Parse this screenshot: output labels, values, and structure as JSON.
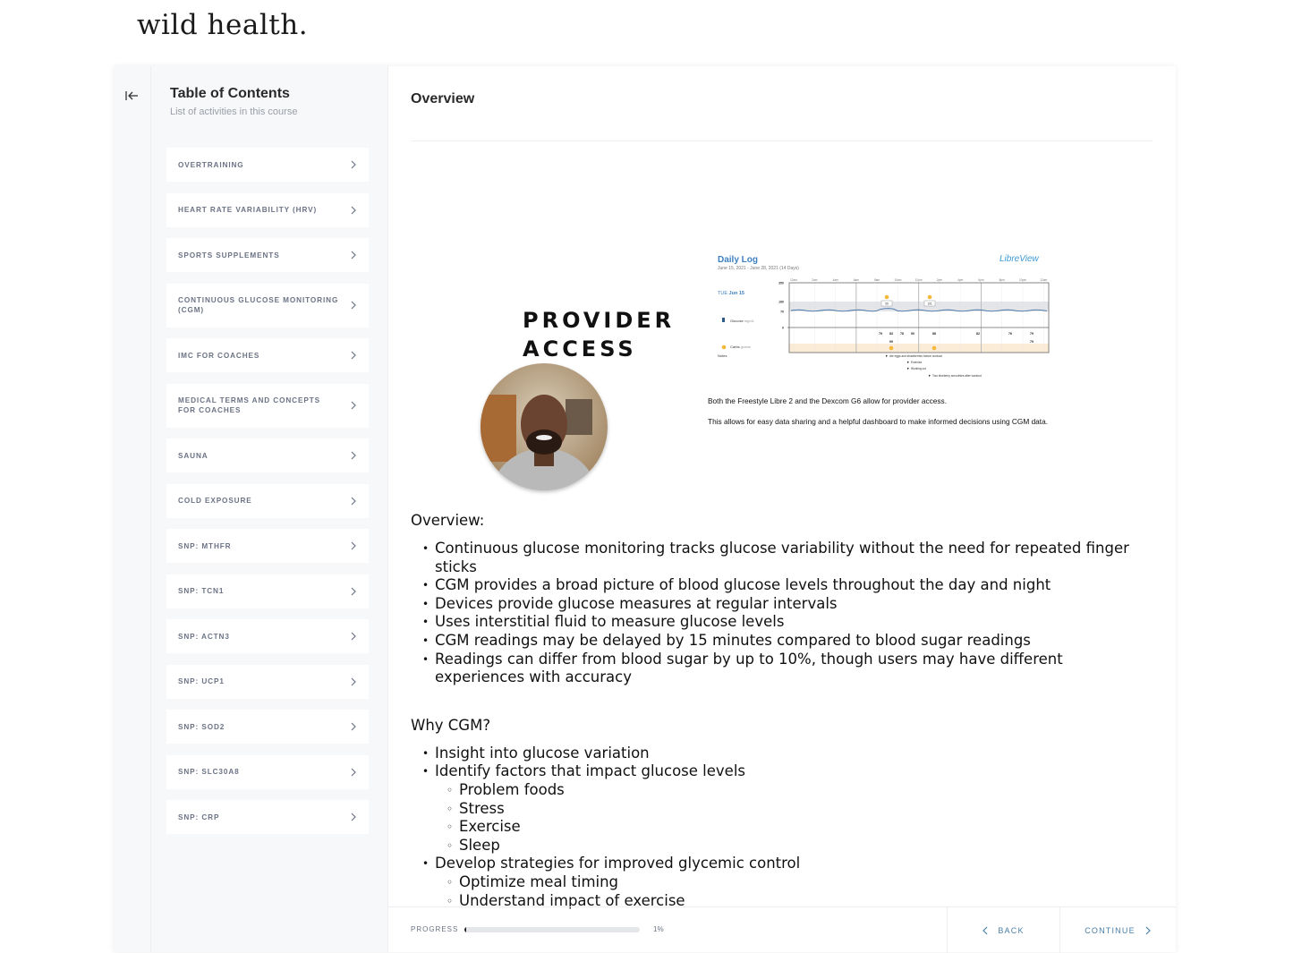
{
  "brand": {
    "logo_text": "wild health."
  },
  "toc": {
    "title": "Table of Contents",
    "subtitle": "List of activities in this course",
    "items": [
      {
        "label": "OVERTRAINING"
      },
      {
        "label": "HEART RATE VARIABILITY (HRV)"
      },
      {
        "label": "SPORTS SUPPLEMENTS"
      },
      {
        "label": "CONTINUOUS GLUCOSE MONITORING (CGM)"
      },
      {
        "label": "IMC FOR COACHES"
      },
      {
        "label": "MEDICAL TERMS AND CONCEPTS FOR COACHES"
      },
      {
        "label": "SAUNA"
      },
      {
        "label": "COLD EXPOSURE"
      },
      {
        "label": "SNP: MTHFR"
      },
      {
        "label": "SNP: TCN1"
      },
      {
        "label": "SNP: ACTN3"
      },
      {
        "label": "SNP: UCP1"
      },
      {
        "label": "SNP: SOD2"
      },
      {
        "label": "SNP: SLC30A8"
      },
      {
        "label": "SNP: CRP"
      }
    ]
  },
  "main": {
    "title": "Overview",
    "slide": {
      "heading_line1": "PROVIDER",
      "heading_line2": "ACCESS",
      "daily_log": {
        "title": "Daily Log",
        "range": "June 15, 2021 - June 28, 2021",
        "days": "(14 Days)",
        "brand": "LibreView",
        "day_label_prefix": "TUE",
        "day_label": "Jun 15",
        "y_ticks": [
          "350",
          "180",
          "70",
          "0"
        ],
        "x_ticks": [
          "12am",
          "2am",
          "4am",
          "6am",
          "8am",
          "10am",
          "12pm",
          "2pm",
          "4pm",
          "6pm",
          "8pm",
          "10pm",
          "12am"
        ],
        "glucose_label": "Glucose",
        "glucose_unit": "mg/dL",
        "carbs_label": "Carbs",
        "carbs_unit": "grams",
        "notes_label": "Notes",
        "flagged_values": [
          "99",
          "101"
        ],
        "readings_row1": [
          "79",
          "83",
          "78",
          "90",
          "88",
          "82",
          "76",
          "79"
        ],
        "readings_row2": [
          "99",
          "79"
        ],
        "notes": [
          "Ate eggs and strawberries before workout",
          "Exercise",
          "Working out",
          "Two blueberry smoothies after workout"
        ]
      },
      "caption1": "Both the Freestyle Libre 2 and the Dexcom G6 allow for provider access.",
      "caption2": "This allows for easy data sharing and a helpful dashboard to make informed decisions using CGM data."
    },
    "overview": {
      "heading": "Overview:",
      "bullets": [
        "Continuous glucose monitoring tracks glucose variability without the need for repeated finger sticks",
        "CGM provides a broad picture of blood glucose levels throughout the day and night",
        "Devices provide glucose measures at regular intervals",
        "Uses interstitial fluid to measure glucose levels",
        "CGM readings may be delayed by 15 minutes compared to blood sugar readings",
        "Readings can differ from blood sugar by up to 10%, though users may have different experiences with accuracy"
      ]
    },
    "why": {
      "heading": "Why CGM?",
      "b1": "Insight into glucose variation",
      "b2": "Identify factors that impact glucose levels",
      "b2_sub": [
        "Problem foods",
        "Stress",
        "Exercise",
        "Sleep"
      ],
      "b3": "Develop strategies for improved glycemic control",
      "b3_sub": [
        "Optimize meal timing",
        "Understand impact of exercise"
      ]
    }
  },
  "footer": {
    "progress_label": "PROGRESS",
    "progress_percent": 1,
    "progress_text": "1%",
    "back_label": "BACK",
    "continue_label": "CONTINUE"
  }
}
